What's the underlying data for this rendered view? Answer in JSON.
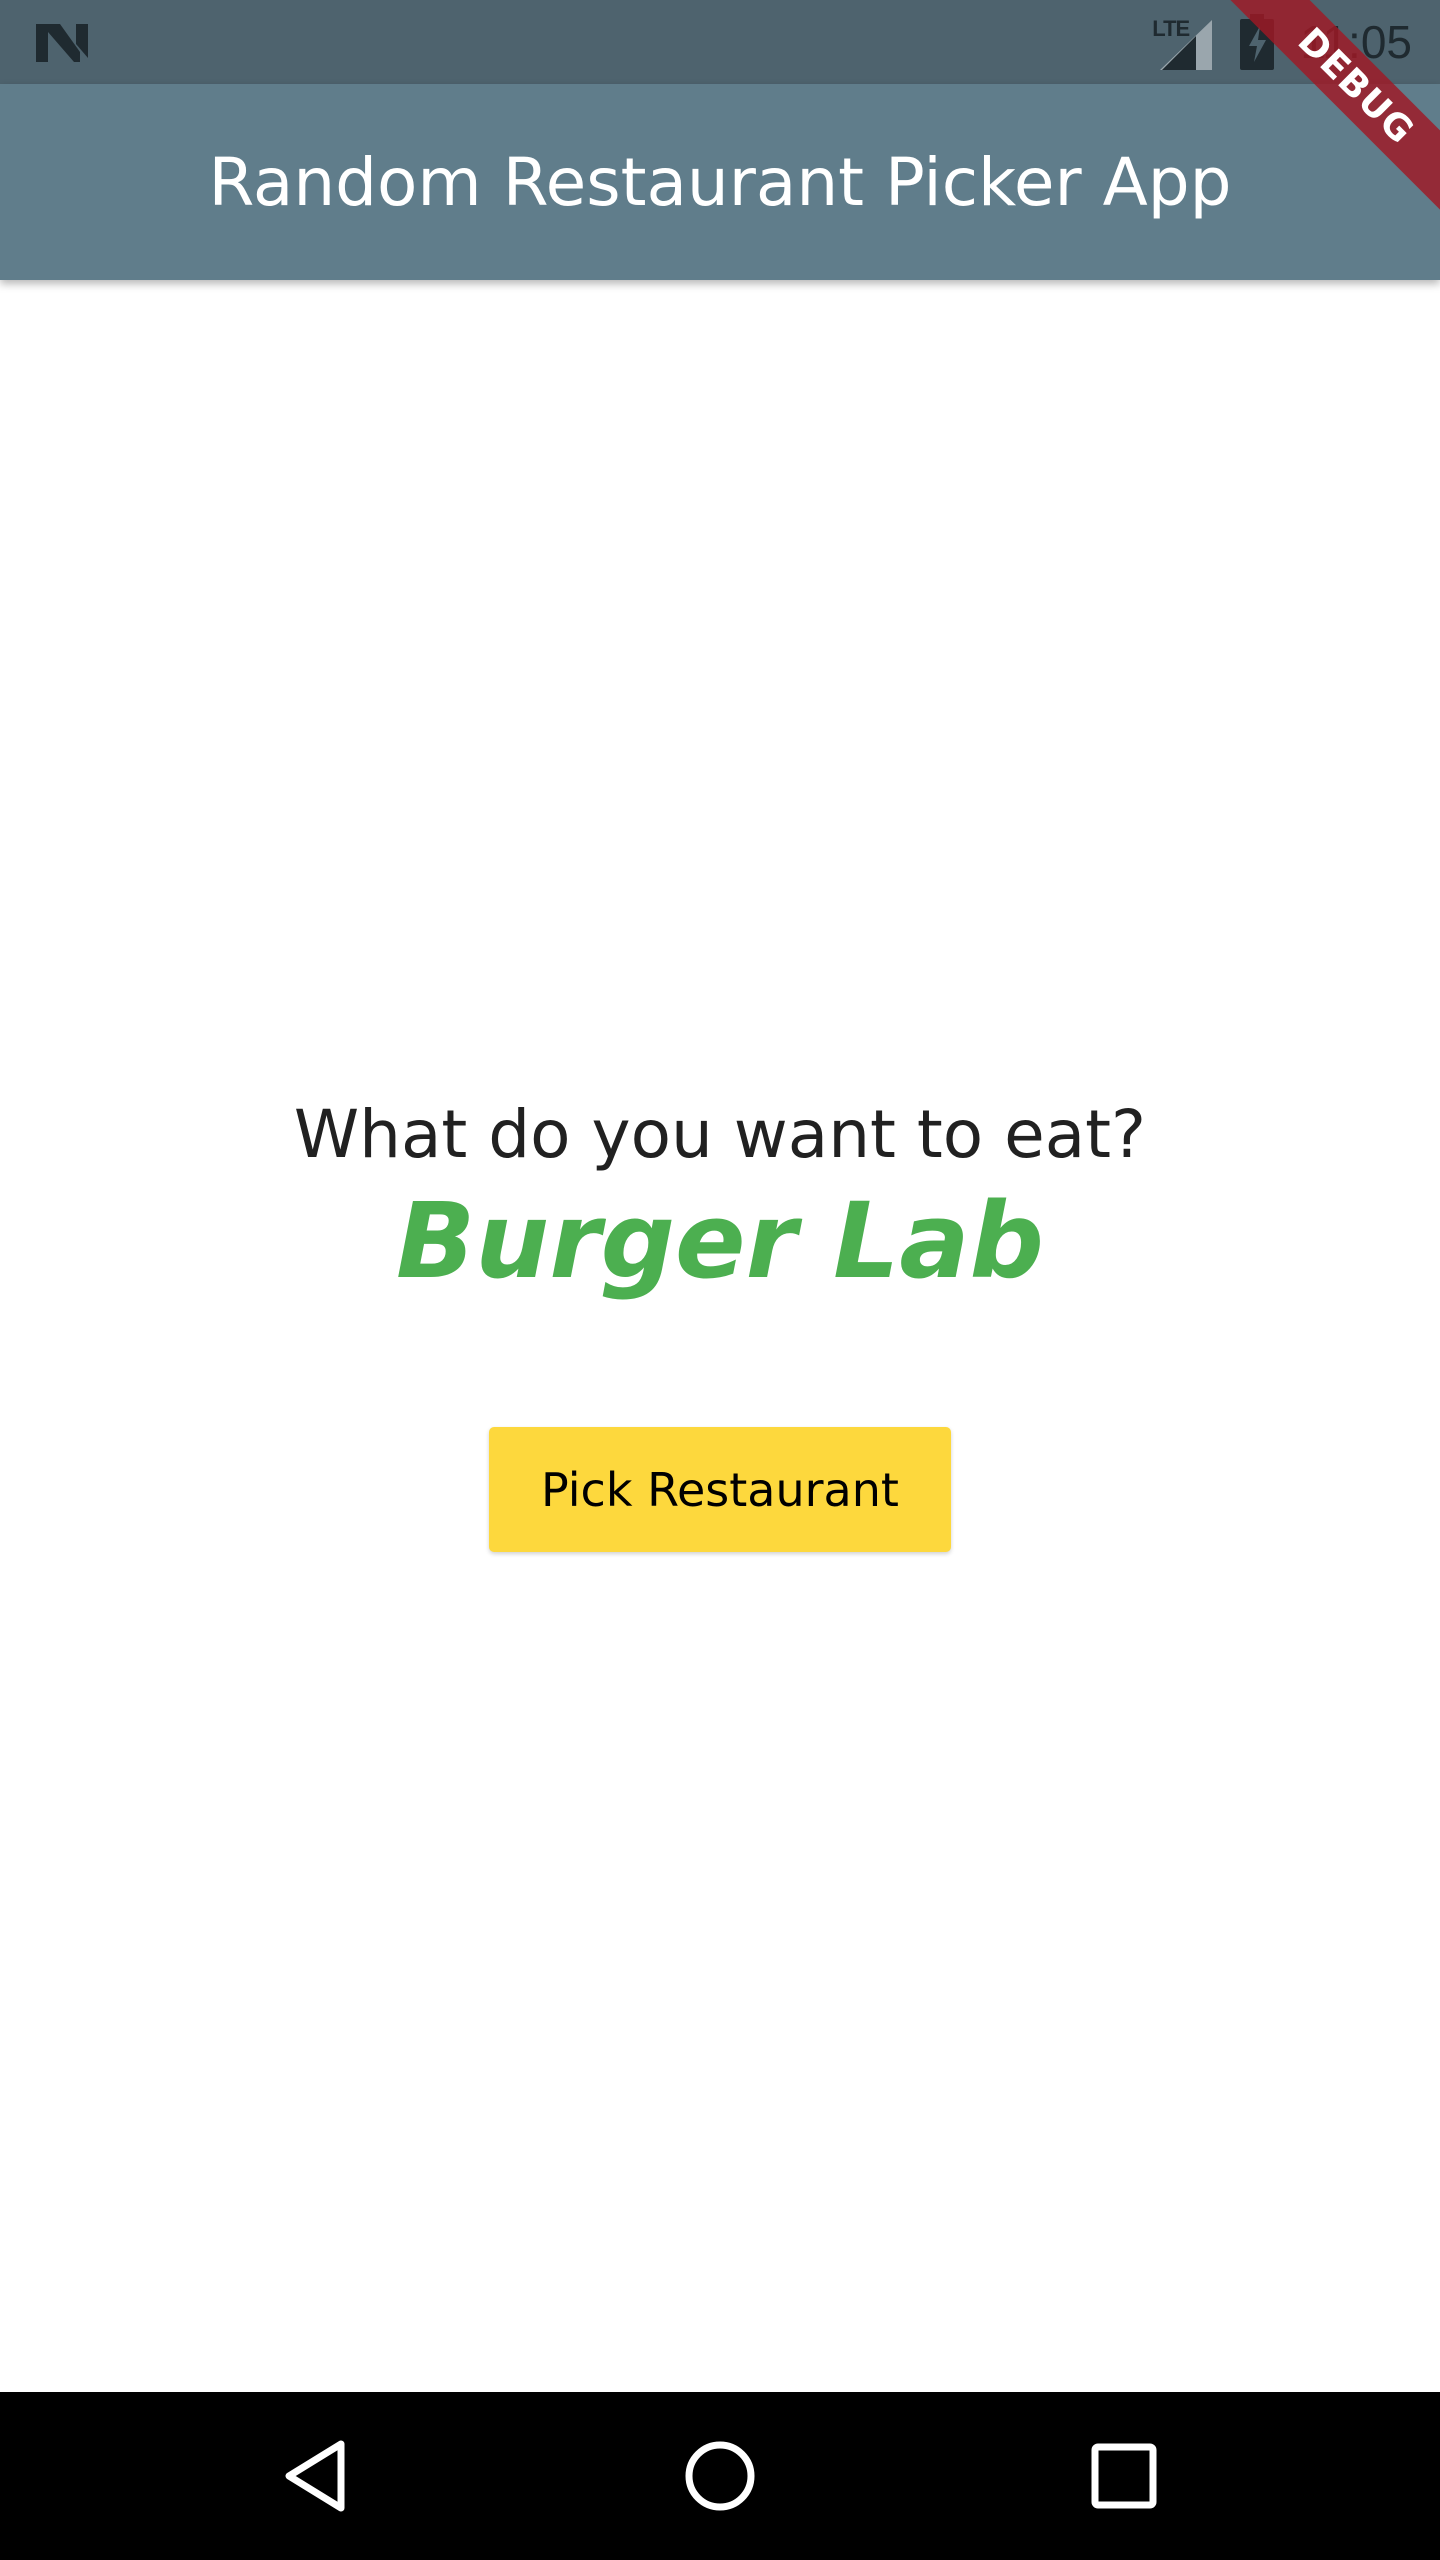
{
  "status_bar": {
    "network_label": "LTE",
    "time": "11:05",
    "icons": [
      "n-notification-icon",
      "lte-signal-icon",
      "battery-charging-icon"
    ]
  },
  "app_bar": {
    "title": "Random Restaurant Picker App"
  },
  "debug_banner": {
    "label": "DEBUG"
  },
  "main": {
    "prompt": "What do you want to eat?",
    "selected_restaurant": "Burger Lab",
    "pick_button_label": "Pick Restaurant"
  },
  "nav_bar": {
    "icons": [
      "back-icon",
      "home-icon",
      "recents-icon"
    ]
  },
  "colors": {
    "status_bar": "#4e636e",
    "app_bar": "#607d8b",
    "result_text": "#4caf50",
    "button": "#fdd83d",
    "debug_banner": "#a01825",
    "nav_bar": "#000000"
  }
}
